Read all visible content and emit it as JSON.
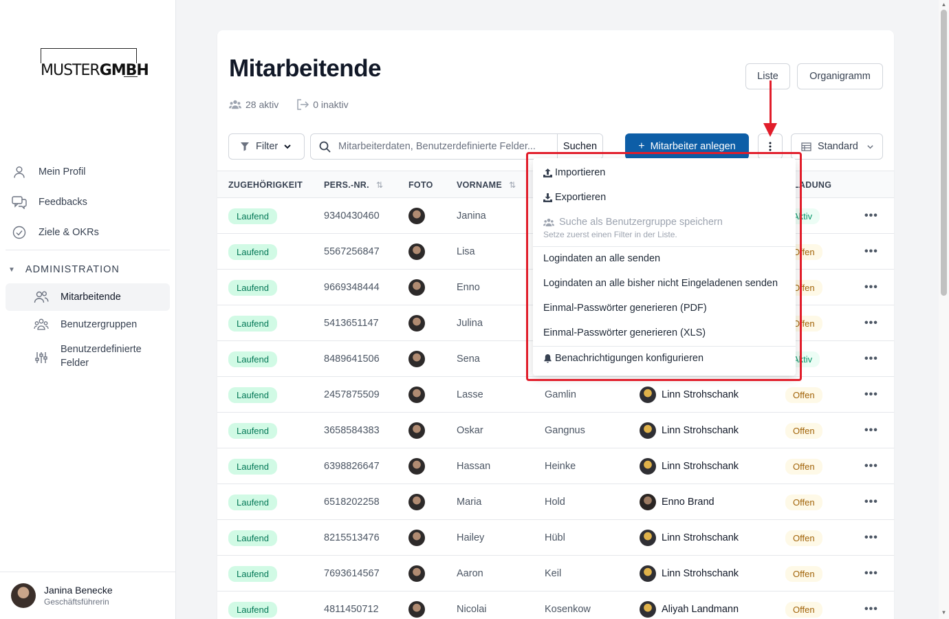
{
  "brand": {
    "logo_left": "MUSTER",
    "logo_right": "GMBH"
  },
  "sidebar": {
    "items": [
      {
        "label": "Mein Profil",
        "icon": "user-icon"
      },
      {
        "label": "Feedbacks",
        "icon": "chat-bubbles-icon"
      },
      {
        "label": "Ziele & OKRs",
        "icon": "check-circle-icon"
      }
    ],
    "admin_heading": "ADMINISTRATION",
    "admin_items": [
      {
        "label": "Mitarbeitende",
        "icon": "users-icon",
        "active": true
      },
      {
        "label": "Benutzergruppen",
        "icon": "user-group-icon"
      },
      {
        "label": "Benutzerdefinierte Felder",
        "icon": "sliders-icon"
      }
    ],
    "user": {
      "name": "Janina Benecke",
      "role": "Geschäftsführerin"
    }
  },
  "header": {
    "title": "Mitarbeitende",
    "active_count": "28 aktiv",
    "inactive_count": "0 inaktiv",
    "view_list": "Liste",
    "view_org": "Organigramm"
  },
  "toolbar": {
    "filter_label": "Filter",
    "search_placeholder": "Mitarbeiterdaten, Benutzerdefinierte Felder...",
    "search_button": "Suchen",
    "create_label": "Mitarbeiter anlegen",
    "create_prefix": "+",
    "view_select": "Standard"
  },
  "table": {
    "headers": {
      "membership": "ZUGEHÖRIGKEIT",
      "pers_nr": "PERS.-NR.",
      "photo": "FOTO",
      "firstname": "VORNAME",
      "invitation": "LADUNG"
    },
    "rows": [
      {
        "status": "Laufend",
        "nr": "9340430460",
        "first": "Janina",
        "last": "",
        "manager": "",
        "invite": "Aktiv"
      },
      {
        "status": "Laufend",
        "nr": "5567256847",
        "first": "Lisa",
        "last": "",
        "manager": "",
        "invite": "Offen"
      },
      {
        "status": "Laufend",
        "nr": "9669348444",
        "first": "Enno",
        "last": "",
        "manager": "",
        "invite": "Offen"
      },
      {
        "status": "Laufend",
        "nr": "5413651147",
        "first": "Julina",
        "last": "",
        "manager": "",
        "invite": "Offen"
      },
      {
        "status": "Laufend",
        "nr": "8489641506",
        "first": "Sena",
        "last": "",
        "manager": "",
        "invite": "Aktiv"
      },
      {
        "status": "Laufend",
        "nr": "2457875509",
        "first": "Lasse",
        "last": "Gamlin",
        "manager": "Linn Strohschank",
        "invite": "Offen"
      },
      {
        "status": "Laufend",
        "nr": "3658584383",
        "first": "Oskar",
        "last": "Gangnus",
        "manager": "Linn Strohschank",
        "invite": "Offen"
      },
      {
        "status": "Laufend",
        "nr": "6398826647",
        "first": "Hassan",
        "last": "Heinke",
        "manager": "Linn Strohschank",
        "invite": "Offen"
      },
      {
        "status": "Laufend",
        "nr": "6518202258",
        "first": "Maria",
        "last": "Hold",
        "manager": "Enno Brand",
        "invite": "Offen"
      },
      {
        "status": "Laufend",
        "nr": "8215513476",
        "first": "Hailey",
        "last": "Hübl",
        "manager": "Linn Strohschank",
        "invite": "Offen"
      },
      {
        "status": "Laufend",
        "nr": "7693614567",
        "first": "Aaron",
        "last": "Keil",
        "manager": "Linn Strohschank",
        "invite": "Offen"
      },
      {
        "status": "Laufend",
        "nr": "4811450712",
        "first": "Nicolai",
        "last": "Kosenkow",
        "manager": "Aliyah Landmann",
        "invite": "Offen"
      }
    ],
    "row_menu": "•••"
  },
  "dropdown": {
    "import": "Importieren",
    "export": "Exportieren",
    "save_group": "Suche als Benutzergruppe speichern",
    "save_group_hint": "Setze zuerst einen Filter in der Liste.",
    "send_all": "Logindaten an alle senden",
    "send_uninvited": "Logindaten an alle bisher nicht Eingeladenen senden",
    "otp_pdf": "Einmal-Passwörter generieren (PDF)",
    "otp_xls": "Einmal-Passwörter generieren (XLS)",
    "notifications": "Benachrichtigungen konfigurieren"
  },
  "colors": {
    "primary": "#0d5ea7",
    "highlight": "#e11d2a",
    "badge_green": "#d1fae5",
    "badge_yellow": "#fef9e7"
  }
}
